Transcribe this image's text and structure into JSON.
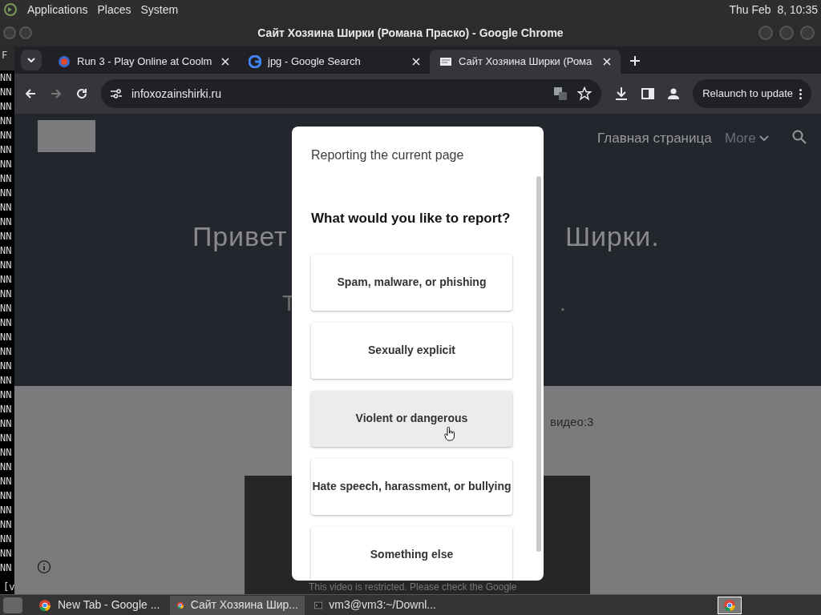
{
  "top_panel": {
    "menus": [
      "Applications",
      "Places",
      "System"
    ],
    "clock": "Thu Feb  8, 10:35"
  },
  "window": {
    "title": "Сайт Хозяина Ширки (Романа Праско) - Google Chrome"
  },
  "terminal": {
    "top_text": "F",
    "lines": [
      "NN",
      "NN",
      "NN",
      "NN",
      "NN",
      "NN",
      "NN",
      "NN",
      "NN",
      "NN",
      "NN",
      "NN",
      "NN",
      "NN",
      "NN",
      "NN",
      "NN",
      "NN",
      "NN",
      "NN",
      "NN",
      "NN",
      "NN",
      "NN",
      "NN",
      "NN",
      "NN",
      "NN",
      "NN",
      "NN",
      "NN",
      "NN",
      "NN",
      "NN",
      "NN"
    ],
    "prompt": "[v"
  },
  "tabs": [
    {
      "label": "Run 3 - Play Online at Coolm",
      "selected": false
    },
    {
      "label": "jpg - Google Search",
      "selected": false
    },
    {
      "label": "Сайт Хозяина Ширки (Рома",
      "selected": true
    }
  ],
  "address_bar": {
    "url": "infoxozainshirki.ru"
  },
  "relaunch_button": "Relaunch to update",
  "site": {
    "nav": [
      "Главная страница",
      "More"
    ],
    "hero_left": "Привет",
    "hero_right": "Ширки.",
    "hero_line2_left": "Т",
    "hero_line2_right": ".",
    "video_count": "видео:3",
    "video_notice": "This video is restricted. Please check the Google"
  },
  "dialog": {
    "title": "Reporting the current page",
    "question": "What would you like to report?",
    "options": [
      {
        "label": "Spam, malware, or phishing",
        "hovered": false
      },
      {
        "label": "Sexually explicit",
        "hovered": false
      },
      {
        "label": "Violent or dangerous",
        "hovered": true
      },
      {
        "label": "Hate speech, harassment, or bullying",
        "hovered": false
      },
      {
        "label": "Something else",
        "hovered": false
      }
    ]
  },
  "taskbar": [
    {
      "label": "New Tab - Google ...",
      "selected": false
    },
    {
      "label": "Сайт Хозяина Шир...",
      "selected": true
    },
    {
      "label": "vm3@vm3:~/Downl...",
      "selected": false
    }
  ]
}
